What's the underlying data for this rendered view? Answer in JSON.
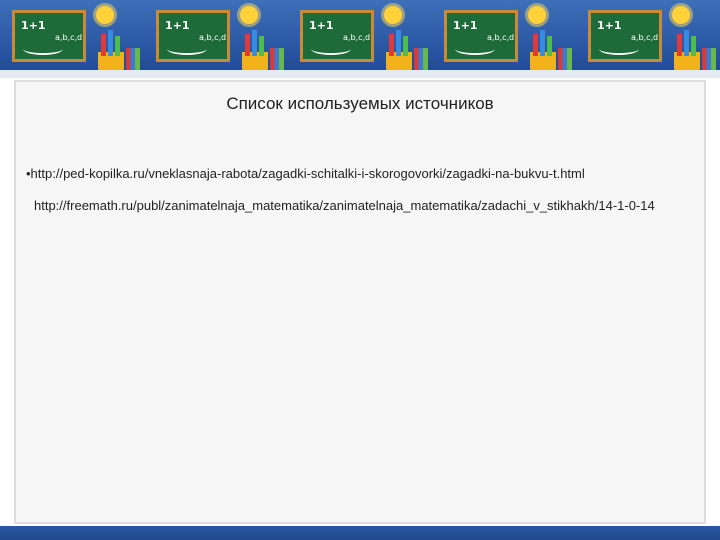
{
  "slide": {
    "title": "Список используемых источников",
    "sources": [
      "•http://ped-kopilka.ru/vneklasnaja-rabota/zagadki-schitalki-i-skorogovorki/zagadki-na-bukvu-t.html",
      "http://freemath.ru/publ/zanimatelnaja_matematika/zanimatelnaja_matematika/zadachi_v_stikhakh/14-1-0-14"
    ]
  },
  "decor": {
    "chalkboard_text": "1+1",
    "chalkboard_sub": "a,b,c,d",
    "border_color": "#2a57a3",
    "chalkboard_color": "#1e6b3a",
    "frame_color": "#c98a3a",
    "sun_color": "#ffd23a",
    "icons": [
      "chalkboard-icon",
      "sun-icon",
      "pencil-cup-icon",
      "books-icon"
    ]
  }
}
